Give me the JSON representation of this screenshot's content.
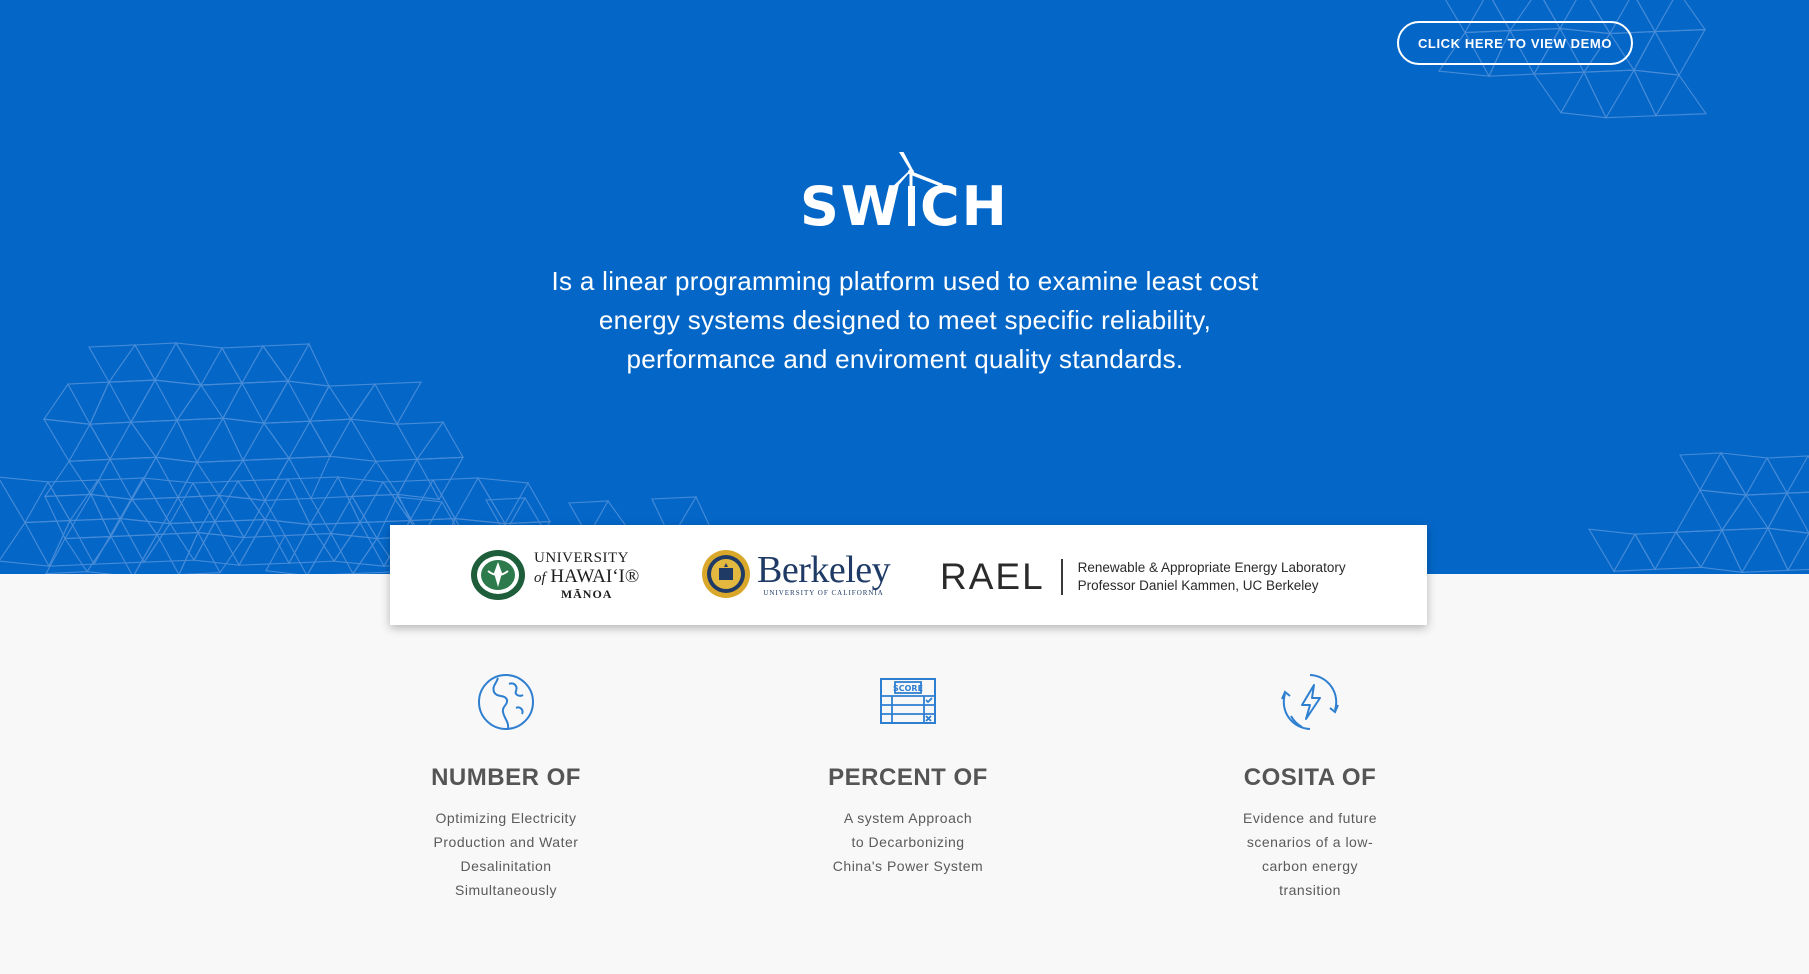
{
  "header": {
    "demo_button": "Click here to view demo"
  },
  "hero": {
    "logo_text": "SWITCH",
    "tagline_lines": [
      "Is a linear programming platform used to examine least cost",
      "energy systems designed to meet specific reliability,",
      "performance and enviroment quality standards."
    ]
  },
  "partners": {
    "uh": {
      "line1": "UNIVERSITY",
      "line2_prefix": "of",
      "line2": "HAWAIʻI®",
      "line3": "MĀNOA"
    },
    "berkeley": {
      "name": "Berkeley",
      "subtitle": "UNIVERSITY OF CALIFORNIA"
    },
    "rael": {
      "acronym": "RAEL",
      "line1": "Renewable & Appropriate Energy Laboratory",
      "line2": "Professor Daniel Kammen, UC Berkeley"
    }
  },
  "features": [
    {
      "icon": "globe-icon",
      "title": "NUMBER OF",
      "desc_lines": [
        "Optimizing Electricity",
        "Production and Water",
        "Desalinitation",
        "Simultaneously"
      ]
    },
    {
      "icon": "scoreboard-icon",
      "title": "PERCENT OF",
      "icon_label": "SCORE",
      "desc_lines": [
        "A system Approach",
        "to Decarbonizing",
        "China's Power System"
      ]
    },
    {
      "icon": "energy-cycle-icon",
      "title": "COSITA OF",
      "desc_lines": [
        "Evidence and future",
        "scenarios of a low-",
        "carbon energy",
        "transition"
      ]
    }
  ],
  "colors": {
    "hero_bg": "#0467c8",
    "icon_blue": "#2f7fd1",
    "page_bg": "#f8f8f8",
    "text_gray": "#555555"
  }
}
